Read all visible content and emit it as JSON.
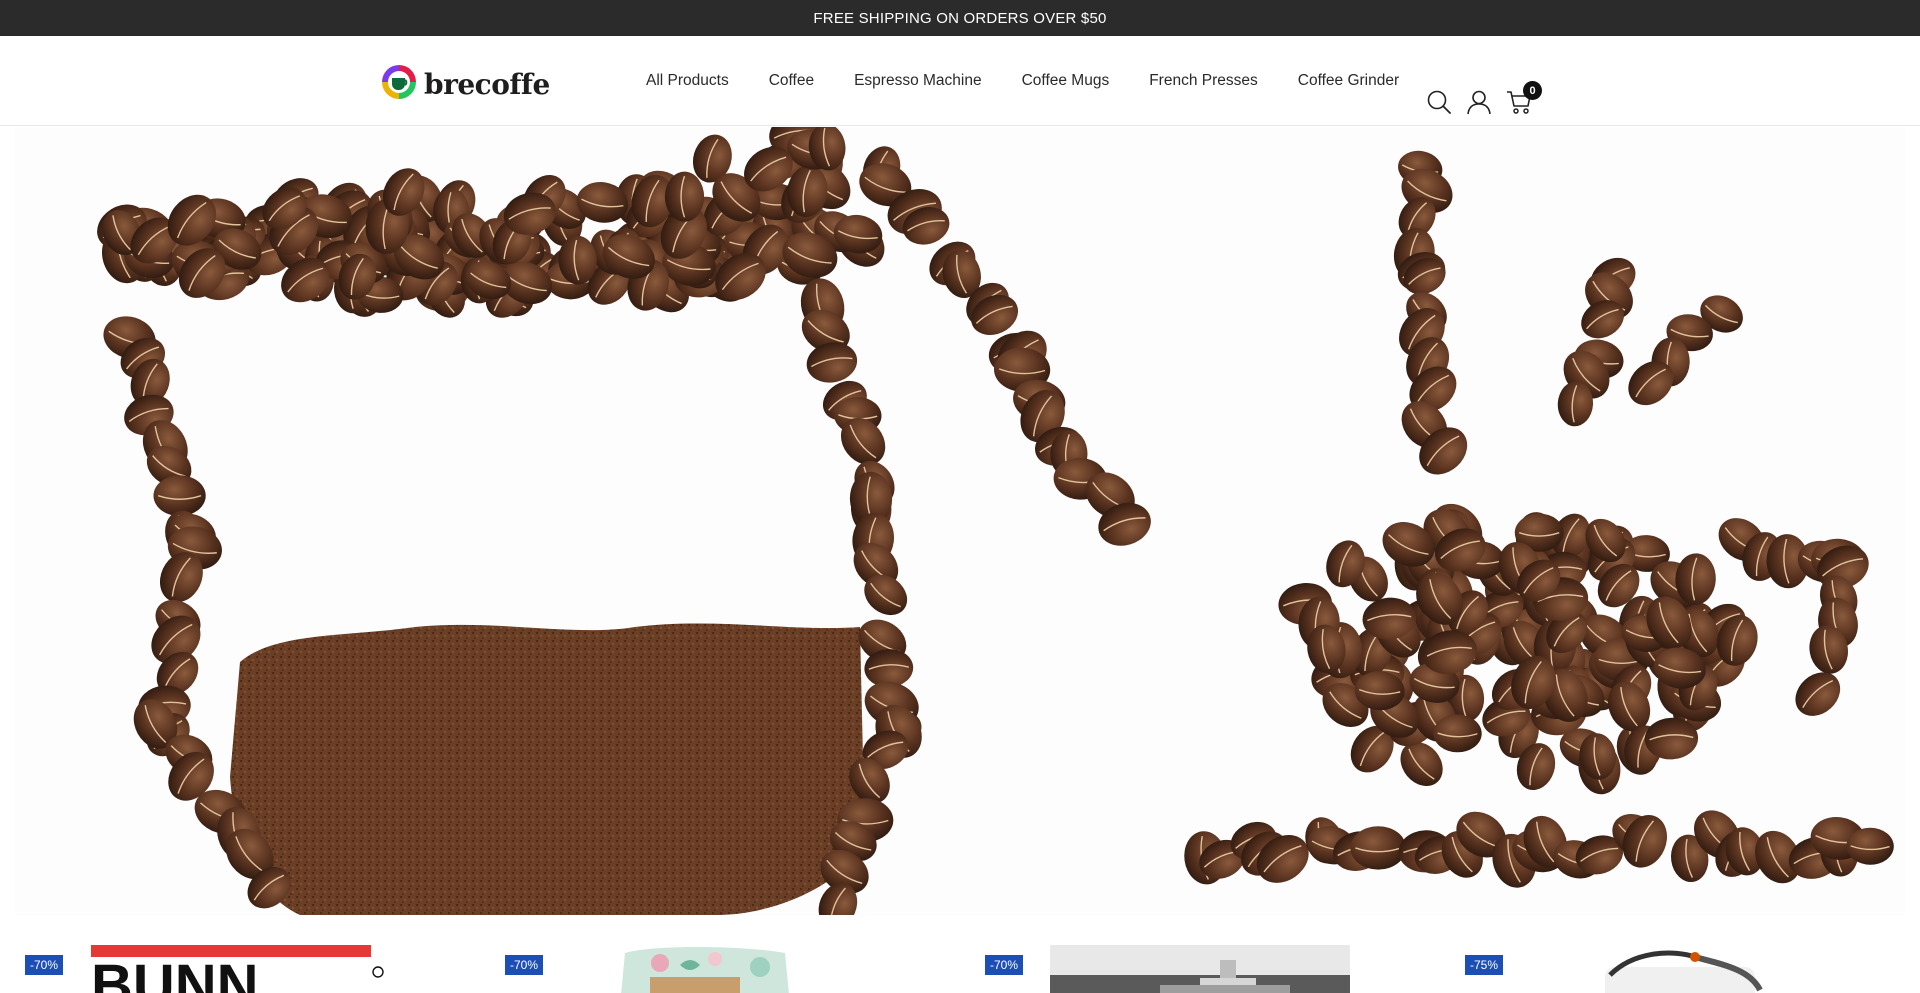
{
  "announcement": {
    "text": "FREE SHIPPING ON ORDERS OVER $50"
  },
  "header": {
    "logo_text": "brecoffe",
    "nav": [
      "All Products",
      "Coffee",
      "Espresso Machine",
      "Coffee Mugs",
      "French Presses",
      "Coffee Grinder"
    ],
    "icons": [
      "search-icon",
      "account-icon",
      "cart-icon"
    ],
    "cart_count": "0"
  },
  "hero": {
    "image": "coffee-beans-pot-and-cup"
  },
  "products": [
    {
      "discount": "-70%",
      "image": "bunn-logo"
    },
    {
      "discount": "-70%",
      "image": "floral-coffee-bag"
    },
    {
      "discount": "-70%",
      "image": "french-press"
    },
    {
      "discount": "-75%",
      "image": "coffee-grinder-cord"
    }
  ],
  "colors": {
    "announcement_bg": "#2b2b2b",
    "badge_bg": "#1b4fb3",
    "bean": "#5a3320"
  }
}
